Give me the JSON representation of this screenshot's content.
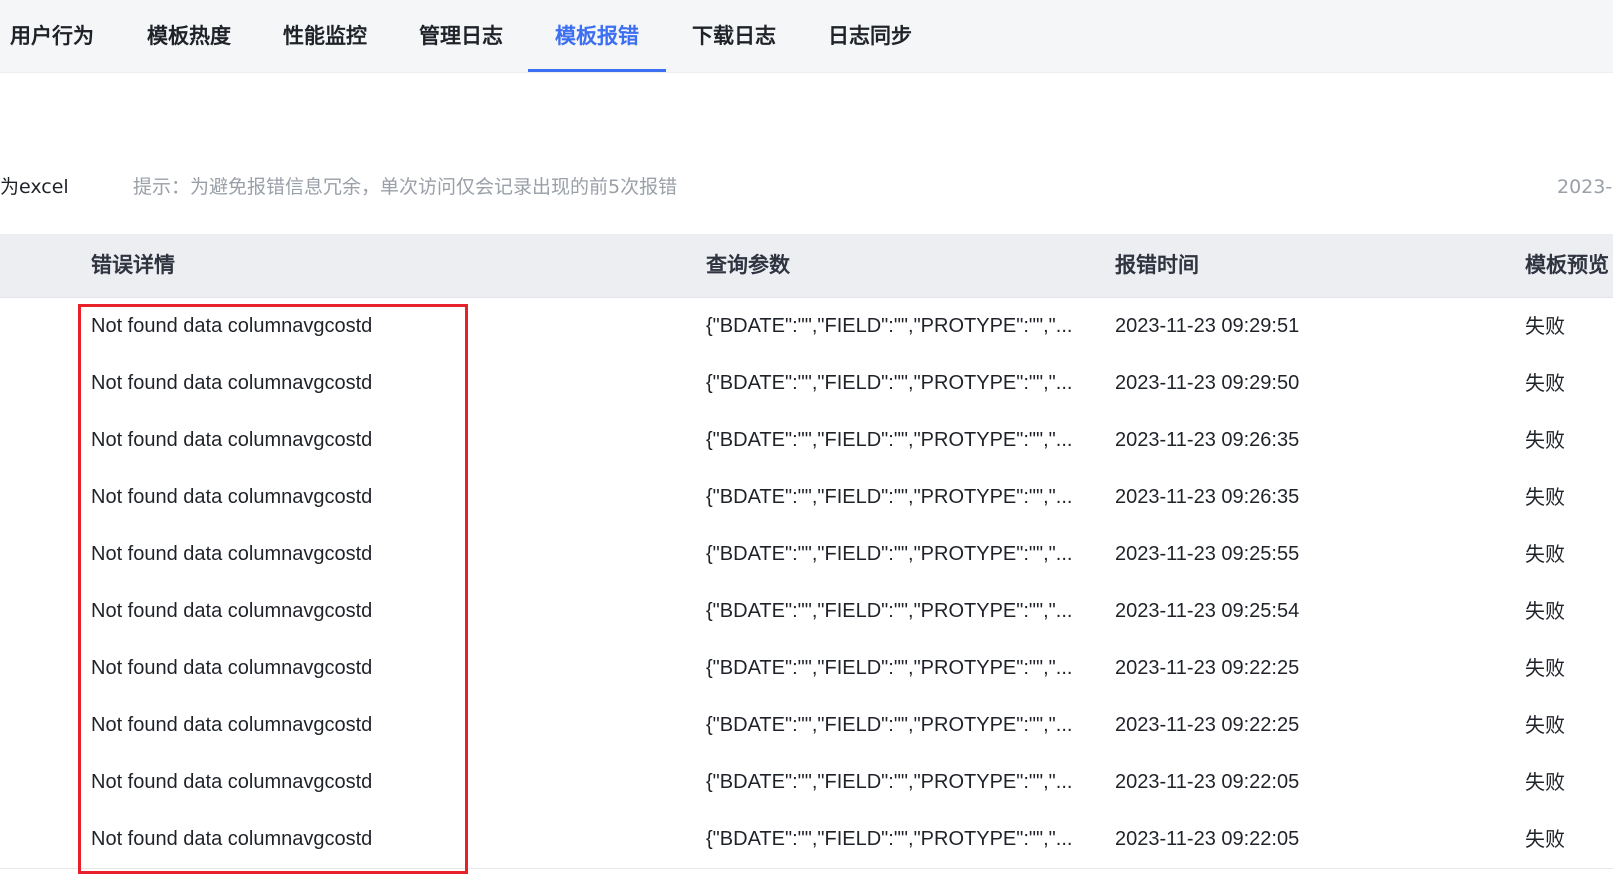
{
  "tabs": [
    {
      "label": "用户行为",
      "active": false
    },
    {
      "label": "模板热度",
      "active": false
    },
    {
      "label": "性能监控",
      "active": false
    },
    {
      "label": "管理日志",
      "active": false
    },
    {
      "label": "模板报错",
      "active": true
    },
    {
      "label": "下载日志",
      "active": false
    },
    {
      "label": "日志同步",
      "active": false
    }
  ],
  "toolbar": {
    "export_label": "为excel",
    "hint": "提示：为避免报错信息冗余，单次访问仅会记录出现的前5次报错",
    "date_partial": "2023-"
  },
  "table": {
    "columns": [
      "错误详情",
      "查询参数",
      "报错时间",
      "模板预览"
    ],
    "rows": [
      {
        "detail": "Not found data columnavgcostd",
        "params": "{\"BDATE\":\"\",\"FIELD\":\"\",\"PROTYPE\":\"\",\"...",
        "time": "2023-11-23 09:29:51",
        "preview": "失败"
      },
      {
        "detail": "Not found data columnavgcostd",
        "params": "{\"BDATE\":\"\",\"FIELD\":\"\",\"PROTYPE\":\"\",\"...",
        "time": "2023-11-23 09:29:50",
        "preview": "失败"
      },
      {
        "detail": "Not found data columnavgcostd",
        "params": "{\"BDATE\":\"\",\"FIELD\":\"\",\"PROTYPE\":\"\",\"...",
        "time": "2023-11-23 09:26:35",
        "preview": "失败"
      },
      {
        "detail": "Not found data columnavgcostd",
        "params": "{\"BDATE\":\"\",\"FIELD\":\"\",\"PROTYPE\":\"\",\"...",
        "time": "2023-11-23 09:26:35",
        "preview": "失败"
      },
      {
        "detail": "Not found data columnavgcostd",
        "params": "{\"BDATE\":\"\",\"FIELD\":\"\",\"PROTYPE\":\"\",\"...",
        "time": "2023-11-23 09:25:55",
        "preview": "失败"
      },
      {
        "detail": "Not found data columnavgcostd",
        "params": "{\"BDATE\":\"\",\"FIELD\":\"\",\"PROTYPE\":\"\",\"...",
        "time": "2023-11-23 09:25:54",
        "preview": "失败"
      },
      {
        "detail": "Not found data columnavgcostd",
        "params": "{\"BDATE\":\"\",\"FIELD\":\"\",\"PROTYPE\":\"\",\"...",
        "time": "2023-11-23 09:22:25",
        "preview": "失败"
      },
      {
        "detail": "Not found data columnavgcostd",
        "params": "{\"BDATE\":\"\",\"FIELD\":\"\",\"PROTYPE\":\"\",\"...",
        "time": "2023-11-23 09:22:25",
        "preview": "失败"
      },
      {
        "detail": "Not found data columnavgcostd",
        "params": "{\"BDATE\":\"\",\"FIELD\":\"\",\"PROTYPE\":\"\",\"...",
        "time": "2023-11-23 09:22:05",
        "preview": "失败"
      },
      {
        "detail": "Not found data columnavgcostd",
        "params": "{\"BDATE\":\"\",\"FIELD\":\"\",\"PROTYPE\":\"\",\"...",
        "time": "2023-11-23 09:22:05",
        "preview": "失败"
      }
    ]
  },
  "colors": {
    "accent": "#3d6ff2",
    "annotation_box": "#e8202a"
  }
}
